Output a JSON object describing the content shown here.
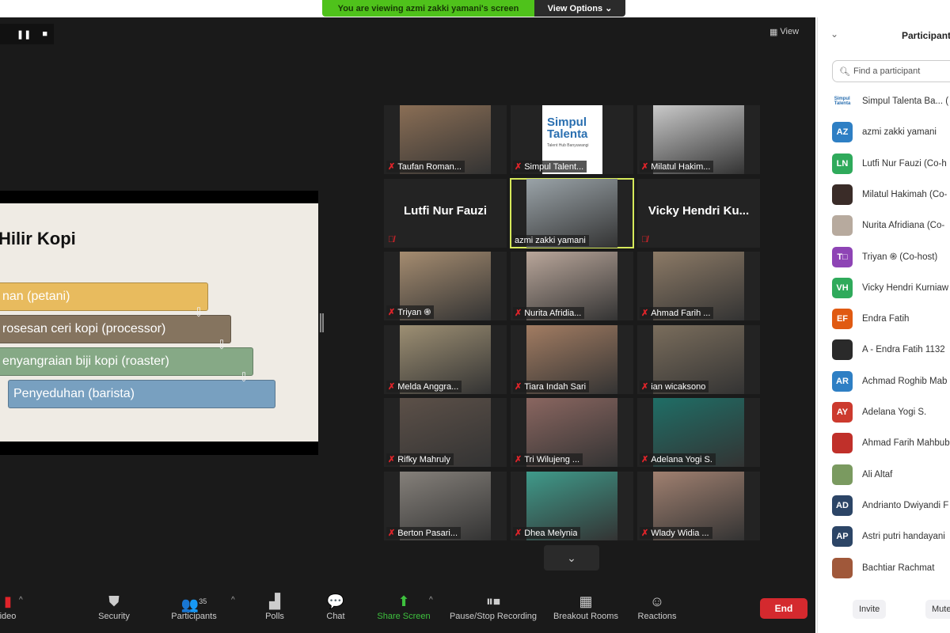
{
  "banner": {
    "text": "You are viewing azmi zakki yamani's screen",
    "view_options": "View Options ⌄"
  },
  "recording": {
    "pause": "❚❚",
    "stop": "■"
  },
  "view_button": "View",
  "slide": {
    "title": "Hilir Kopi",
    "steps": [
      "nan (petani)",
      "rosesan ceri kopi (processor)",
      "enyangraian biji kopi (roaster)",
      "Penyeduhan (barista)"
    ],
    "colors": [
      "#e8bb5e",
      "#85745f",
      "#86a986",
      "#78a0c0"
    ]
  },
  "tiles": [
    {
      "name": "Taufan Roman...",
      "muted": true,
      "bg": "#8a6e55"
    },
    {
      "name": "Simpul Talent...",
      "muted": true,
      "logo": "Simpul\nTalenta",
      "logo_sub": "Talent Hub Banyuwangi"
    },
    {
      "name": "Milatul Hakim...",
      "muted": true,
      "bg": "#c9c9c9"
    },
    {
      "name": "Lutfi Nur Fauzi",
      "muted": true,
      "no_video": true
    },
    {
      "name": "azmi zakki yamani",
      "muted": false,
      "bg": "#9aa3a8",
      "active": true
    },
    {
      "name": "Vicky Hendri Ku...",
      "muted": true,
      "no_video": true
    },
    {
      "name": "Triyan ֍",
      "muted": true,
      "bg": "#a58c70"
    },
    {
      "name": "Nurita Afridia...",
      "muted": true,
      "bg": "#b9a69a"
    },
    {
      "name": "Ahmad Farih ...",
      "muted": true,
      "bg": "#8c7a66"
    },
    {
      "name": "Melda Anggra...",
      "muted": true,
      "bg": "#9d8f73"
    },
    {
      "name": "Tiara Indah Sari",
      "muted": true,
      "bg": "#a27c62"
    },
    {
      "name": "ian wicaksono",
      "muted": true,
      "bg": "#7a6d5c"
    },
    {
      "name": "Rifky Mahruly",
      "muted": true,
      "bg": "#5c5048"
    },
    {
      "name": "Tri Wilujeng ...",
      "muted": true,
      "bg": "#8a6660"
    },
    {
      "name": "Adelana Yogi S.",
      "muted": true,
      "bg": "#1f6e66"
    },
    {
      "name": "Berton Pasari...",
      "muted": true,
      "bg": "#85807a"
    },
    {
      "name": "Dhea Melynia",
      "muted": true,
      "bg": "#3f9a8a"
    },
    {
      "name": "Wlady Widia ...",
      "muted": true,
      "bg": "#a08070"
    }
  ],
  "toolbar": {
    "video": "ideo",
    "security": "Security",
    "participants": "Participants",
    "participants_count": "35",
    "polls": "Polls",
    "chat": "Chat",
    "share": "Share Screen",
    "record": "Pause/Stop Recording",
    "breakout": "Breakout Rooms",
    "reactions": "Reactions",
    "end": "End",
    "share_color": "#3ec13e"
  },
  "panel": {
    "title": "Participant",
    "search_placeholder": "Find a participant",
    "invite": "Invite",
    "mute": "Mute",
    "participants": [
      {
        "initials": "",
        "name": "Simpul Talenta Ba... (",
        "color": "#ffffff",
        "logo": true
      },
      {
        "initials": "AZ",
        "name": "azmi zakki yamani",
        "color": "#2e7fc4"
      },
      {
        "initials": "LN",
        "name": "Lutfi Nur Fauzi  (Co-h",
        "color": "#2faa5b"
      },
      {
        "initials": "",
        "name": "Milatul Hakimah (Co-",
        "color": "#3a2c28"
      },
      {
        "initials": "",
        "name": "Nurita Afridiana (Co-",
        "color": "#b7aa9e"
      },
      {
        "initials": "T□",
        "name": "Triyan ֍ (Co-host)",
        "color": "#8e44b5"
      },
      {
        "initials": "VH",
        "name": "Vicky Hendri Kurniaw",
        "color": "#2faa5b"
      },
      {
        "initials": "EF",
        "name": " Endra Fatih",
        "color": "#e05a12"
      },
      {
        "initials": "",
        "name": "A - Endra Fatih 1132",
        "color": "#2a2a2a"
      },
      {
        "initials": "AR",
        "name": "Achmad Roghib Mab",
        "color": "#2e7fc4"
      },
      {
        "initials": "AY",
        "name": "Adelana Yogi S.",
        "color": "#cc3a2e"
      },
      {
        "initials": "",
        "name": "Ahmad Farih Mahbub",
        "color": "#c0302a"
      },
      {
        "initials": "",
        "name": "Ali Altaf",
        "color": "#7a9a60"
      },
      {
        "initials": "AD",
        "name": "Andrianto Dwiyandi F",
        "color": "#2c4566"
      },
      {
        "initials": "AP",
        "name": "Astri putri handayani",
        "color": "#2c4566"
      },
      {
        "initials": "",
        "name": "Bachtiar Rachmat",
        "color": "#a0583a"
      }
    ]
  }
}
